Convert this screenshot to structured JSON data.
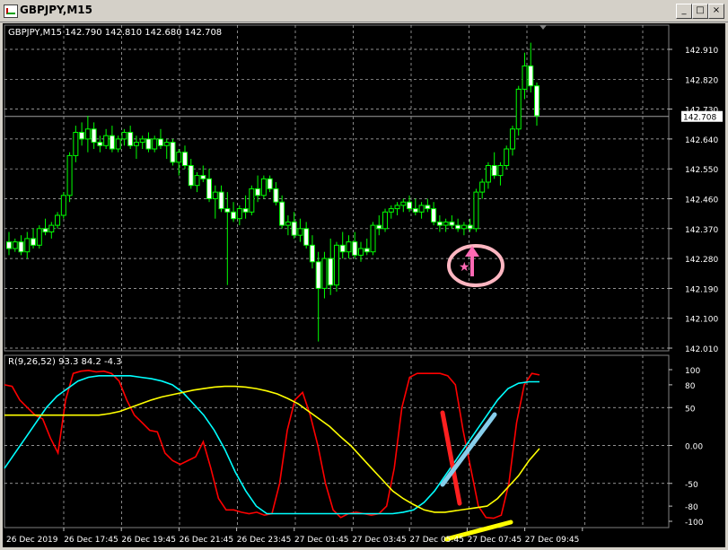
{
  "window": {
    "title": "GBPJPY,M15",
    "buttons": {
      "minimize": "_",
      "maximize": "□",
      "close": "×"
    }
  },
  "colors": {
    "background": "#000000",
    "grid": "#c0c0c0",
    "candle": "#00ff00",
    "text": "#ffffff",
    "stoch_main": "#ff0000",
    "stoch_signal": "#00ffff",
    "stoch_slow": "#ffff00",
    "annotation_pink": "#ff69b4",
    "annotation_red": "#ff2020",
    "annotation_blue": "#87ceeb",
    "annotation_yellow": "#ffff00"
  },
  "chart_data": [
    {
      "type": "candlestick",
      "title": "GBPJPY,M15  142.790 142.810 142.680 142.708",
      "y_ticks": [
        "142.910",
        "142.820",
        "142.730",
        "142.640",
        "142.550",
        "142.460",
        "142.370",
        "142.280",
        "142.190",
        "142.100",
        "142.010"
      ],
      "ylim": [
        142.01,
        142.91
      ],
      "current_price": "142.708",
      "candles": [
        [
          142.33,
          142.36,
          142.29,
          142.31
        ],
        [
          142.31,
          142.34,
          142.3,
          142.33
        ],
        [
          142.33,
          142.35,
          142.29,
          142.3
        ],
        [
          142.3,
          142.36,
          142.28,
          142.34
        ],
        [
          142.34,
          142.37,
          142.31,
          142.32
        ],
        [
          142.32,
          142.38,
          142.31,
          142.37
        ],
        [
          142.37,
          142.4,
          142.35,
          142.36
        ],
        [
          142.36,
          142.39,
          142.34,
          142.38
        ],
        [
          142.38,
          142.42,
          142.37,
          142.41
        ],
        [
          142.41,
          142.48,
          142.4,
          142.47
        ],
        [
          142.47,
          142.6,
          142.45,
          142.59
        ],
        [
          142.59,
          142.68,
          142.57,
          142.66
        ],
        [
          142.66,
          142.69,
          142.62,
          142.64
        ],
        [
          142.64,
          142.71,
          142.6,
          142.67
        ],
        [
          142.67,
          142.69,
          142.61,
          142.63
        ],
        [
          142.63,
          142.65,
          142.6,
          142.62
        ],
        [
          142.62,
          142.67,
          142.61,
          142.65
        ],
        [
          142.65,
          142.68,
          142.6,
          142.61
        ],
        [
          142.61,
          142.65,
          142.6,
          142.64
        ],
        [
          142.64,
          142.67,
          142.62,
          142.66
        ],
        [
          142.66,
          142.68,
          142.61,
          142.62
        ],
        [
          142.62,
          142.65,
          142.58,
          142.63
        ],
        [
          142.63,
          142.65,
          142.61,
          142.64
        ],
        [
          142.64,
          142.66,
          142.6,
          142.61
        ],
        [
          142.61,
          142.65,
          142.6,
          142.64
        ],
        [
          142.64,
          142.67,
          142.61,
          142.62
        ],
        [
          142.62,
          142.64,
          142.58,
          142.63
        ],
        [
          142.63,
          142.64,
          142.56,
          142.57
        ],
        [
          142.57,
          142.61,
          142.53,
          142.6
        ],
        [
          142.6,
          142.62,
          142.55,
          142.56
        ],
        [
          142.56,
          142.58,
          142.49,
          142.5
        ],
        [
          142.5,
          142.54,
          142.48,
          142.53
        ],
        [
          142.53,
          142.56,
          142.51,
          142.52
        ],
        [
          142.52,
          142.55,
          142.45,
          142.46
        ],
        [
          142.46,
          142.5,
          142.4,
          142.48
        ],
        [
          142.48,
          142.5,
          142.42,
          142.43
        ],
        [
          142.43,
          142.48,
          142.2,
          142.42
        ],
        [
          142.42,
          142.45,
          142.39,
          142.4
        ],
        [
          142.4,
          142.44,
          142.38,
          142.43
        ],
        [
          142.43,
          142.47,
          142.4,
          142.42
        ],
        [
          142.42,
          142.5,
          142.41,
          142.49
        ],
        [
          142.49,
          142.53,
          142.45,
          142.47
        ],
        [
          142.47,
          142.53,
          142.46,
          142.52
        ],
        [
          142.52,
          142.53,
          142.48,
          142.49
        ],
        [
          142.49,
          142.51,
          142.44,
          142.45
        ],
        [
          142.45,
          142.47,
          142.37,
          142.38
        ],
        [
          142.38,
          142.41,
          142.35,
          142.39
        ],
        [
          142.39,
          142.42,
          142.34,
          142.35
        ],
        [
          142.35,
          142.4,
          142.33,
          142.37
        ],
        [
          142.37,
          142.39,
          142.31,
          142.32
        ],
        [
          142.32,
          142.35,
          142.25,
          142.27
        ],
        [
          142.27,
          142.3,
          142.03,
          142.19
        ],
        [
          142.19,
          142.3,
          142.16,
          142.28
        ],
        [
          142.28,
          142.34,
          142.17,
          142.2
        ],
        [
          142.2,
          142.33,
          142.18,
          142.32
        ],
        [
          142.32,
          142.36,
          142.28,
          142.3
        ],
        [
          142.3,
          142.35,
          142.28,
          142.33
        ],
        [
          142.33,
          142.36,
          142.28,
          142.29
        ],
        [
          142.29,
          142.33,
          142.27,
          142.31
        ],
        [
          142.31,
          142.34,
          142.29,
          142.3
        ],
        [
          142.3,
          142.39,
          142.29,
          142.38
        ],
        [
          142.38,
          142.41,
          142.35,
          142.37
        ],
        [
          142.37,
          142.43,
          142.36,
          142.42
        ],
        [
          142.42,
          142.44,
          142.4,
          142.43
        ],
        [
          142.43,
          142.45,
          142.41,
          142.44
        ],
        [
          142.44,
          142.46,
          142.42,
          142.45
        ],
        [
          142.45,
          142.47,
          142.42,
          142.43
        ],
        [
          142.43,
          142.46,
          142.41,
          142.42
        ],
        [
          142.42,
          142.45,
          142.4,
          142.44
        ],
        [
          142.44,
          142.46,
          142.42,
          142.43
        ],
        [
          142.43,
          142.45,
          142.38,
          142.39
        ],
        [
          142.39,
          142.41,
          142.36,
          142.38
        ],
        [
          142.38,
          142.4,
          142.36,
          142.39
        ],
        [
          142.39,
          142.41,
          142.37,
          142.38
        ],
        [
          142.38,
          142.4,
          142.36,
          142.37
        ],
        [
          142.37,
          142.39,
          142.35,
          142.38
        ],
        [
          142.38,
          142.4,
          142.36,
          142.37
        ],
        [
          142.37,
          142.49,
          142.36,
          142.48
        ],
        [
          142.48,
          142.52,
          142.46,
          142.51
        ],
        [
          142.51,
          142.57,
          142.49,
          142.56
        ],
        [
          142.56,
          142.6,
          142.52,
          142.53
        ],
        [
          142.53,
          142.57,
          142.5,
          142.56
        ],
        [
          142.56,
          142.62,
          142.55,
          142.61
        ],
        [
          142.61,
          142.68,
          142.59,
          142.67
        ],
        [
          142.67,
          142.8,
          142.65,
          142.79
        ],
        [
          142.79,
          142.9,
          142.76,
          142.86
        ],
        [
          142.86,
          142.93,
          142.78,
          142.8
        ],
        [
          142.8,
          142.81,
          142.68,
          142.71
        ]
      ],
      "annotation": {
        "circle_color": "#ffb6c1",
        "arrow": "up",
        "star": "★"
      }
    },
    {
      "type": "line",
      "title": "R(9,26,52) 93.3 84.2 -4.3",
      "y_ticks": [
        "100",
        "80",
        "50",
        "0.00",
        "-50",
        "-80",
        "-100"
      ],
      "ylim": [
        -100,
        100
      ],
      "x_ticks": [
        "26 Dec 2019",
        "26 Dec 17:45",
        "26 Dec 19:45",
        "26 Dec 21:45",
        "26 Dec 23:45",
        "27 Dec 01:45",
        "27 Dec 03:45",
        "27 Dec 05:45",
        "27 Dec 07:45",
        "27 Dec 09:45"
      ],
      "series": [
        {
          "color": "#ff0000",
          "values": [
            80,
            78,
            60,
            50,
            40,
            35,
            10,
            -10,
            60,
            95,
            98,
            99,
            97,
            98,
            95,
            85,
            60,
            40,
            30,
            20,
            18,
            -10,
            -20,
            -25,
            -20,
            -15,
            5,
            -30,
            -70,
            -85,
            -85,
            -88,
            -90,
            -88,
            -92,
            -90,
            -50,
            20,
            60,
            70,
            40,
            0,
            -50,
            -85,
            -95,
            -90,
            -88,
            -90,
            -92,
            -90,
            -80,
            -30,
            50,
            90,
            95,
            95,
            95,
            95,
            92,
            80,
            20,
            -30,
            -80,
            -95,
            -96,
            -92,
            -50,
            30,
            80,
            95,
            93
          ]
        },
        {
          "color": "#00ffff",
          "values": [
            -30,
            -10,
            10,
            30,
            50,
            65,
            75,
            85,
            90,
            92,
            92,
            92,
            92,
            90,
            88,
            85,
            80,
            70,
            55,
            40,
            20,
            -5,
            -35,
            -60,
            -80,
            -90,
            -90,
            -90,
            -90,
            -90,
            -90,
            -90,
            -90,
            -90,
            -90,
            -90,
            -90,
            -90,
            -88,
            -85,
            -75,
            -60,
            -40,
            -20,
            0,
            20,
            40,
            60,
            75,
            82,
            84,
            84
          ]
        },
        {
          "color": "#ffff00",
          "values": [
            40,
            40,
            40,
            40,
            40,
            40,
            40,
            40,
            40,
            40,
            42,
            45,
            50,
            55,
            60,
            64,
            67,
            70,
            73,
            75,
            77,
            78,
            78,
            77,
            75,
            72,
            68,
            62,
            55,
            45,
            35,
            25,
            12,
            0,
            -15,
            -30,
            -45,
            -60,
            -70,
            -78,
            -85,
            -88,
            -88,
            -86,
            -84,
            -82,
            -80,
            -70,
            -55,
            -40,
            -20,
            -4
          ]
        }
      ]
    }
  ]
}
